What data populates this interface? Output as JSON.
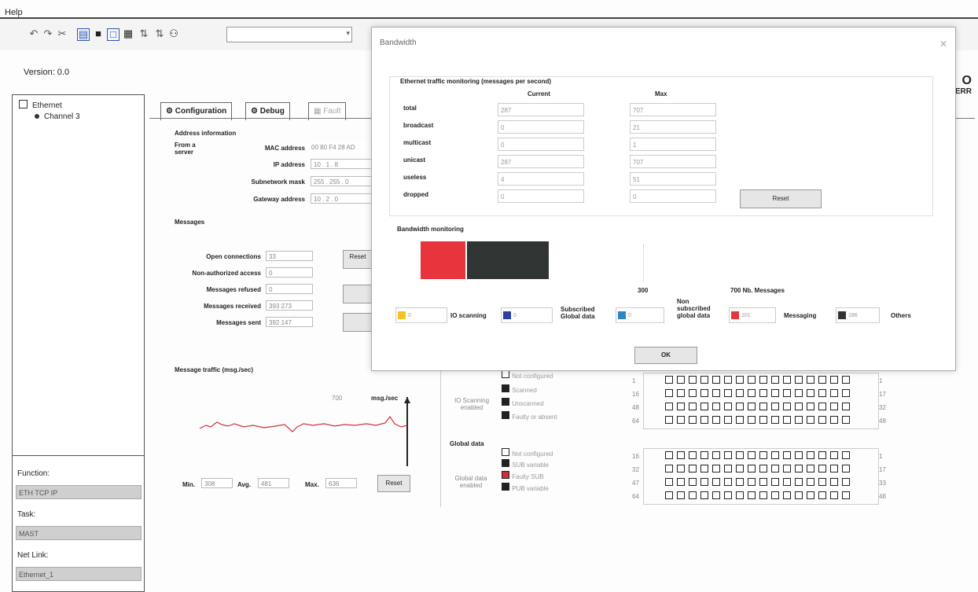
{
  "menu": {
    "help": "Help"
  },
  "toolbar": {
    "icons": [
      "undo-icon",
      "redo-icon",
      "cut-icon",
      "view-icon",
      "doc-icon",
      "frame-icon",
      "print-icon",
      "find-prev-icon",
      "find-next-icon",
      "binoculars-icon"
    ],
    "combo_value": ""
  },
  "version": "Version: 0.0",
  "corner_right": {
    "line1": "O",
    "line2": "ERR"
  },
  "tree": {
    "root": "Ethernet",
    "child": "Channel 3"
  },
  "left_fields": [
    {
      "label": "Function:",
      "value": "ETH TCP IP"
    },
    {
      "label": "Task:",
      "value": "MAST"
    },
    {
      "label": "Net Link:",
      "value": "Ethernet_1"
    }
  ],
  "tabs": [
    "Configuration",
    "Debug",
    "Fault"
  ],
  "address": {
    "title": "Address information",
    "from_label": "From a server",
    "rows": [
      {
        "label": "MAC address",
        "value": "00 80 F4 28 AD"
      },
      {
        "label": "IP address",
        "value": "10 . 1 . 8"
      },
      {
        "label": "Subnetwork mask",
        "value": "255 . 255 . 0"
      },
      {
        "label": "Gateway address",
        "value": "10 . 2 . 0"
      }
    ]
  },
  "messages": {
    "title": "Messages",
    "rows": [
      {
        "label": "Open connections",
        "value": "33"
      },
      {
        "label": "Non-authorized access",
        "value": "0"
      },
      {
        "label": "Messages refused",
        "value": "0"
      },
      {
        "label": "Messages received",
        "value": "393 273"
      },
      {
        "label": "Messages sent",
        "value": "392 147"
      }
    ],
    "reset_label": "Reset"
  },
  "traffic": {
    "title": "Message traffic (msg./sec)",
    "max_tick": "700",
    "unit": "msg./sec",
    "min_label": "Min.",
    "min_value": "308",
    "avg_label": "Avg.",
    "avg_value": "481",
    "max_label": "Max.",
    "max_value": "636",
    "reset_label": "Reset",
    "line_color": "#d0343a"
  },
  "io_scanning": {
    "label_line1": "IO Scanning",
    "label_line2": "enabled",
    "legend": [
      "Not configured",
      "Scanned",
      "Unscanned",
      "Faulty or absent"
    ],
    "row_left": [
      "1",
      "16",
      "48",
      "64"
    ],
    "row_right": [
      "1",
      "17",
      "32",
      "48"
    ]
  },
  "global_data": {
    "title": "Global data",
    "label_line1": "Global data",
    "label_line2": "enabled",
    "legend": [
      "Not configured",
      "SUB variable",
      "Faulty SUB",
      "PUB variable"
    ],
    "row_left": [
      "16",
      "32",
      "47",
      "64"
    ],
    "row_right": [
      "1",
      "17",
      "33",
      "48"
    ]
  },
  "bandwidth": {
    "title": "Bandwidth",
    "ethernet_title": "Ethernet traffic monitoring (messages per second)",
    "col_current": "Current",
    "col_max": "Max",
    "rows": [
      {
        "label": "total",
        "current": "287",
        "max": "707"
      },
      {
        "label": "broadcast",
        "current": "0",
        "max": "21"
      },
      {
        "label": "multicast",
        "current": "0",
        "max": "1"
      },
      {
        "label": "unicast",
        "current": "287",
        "max": "707"
      },
      {
        "label": "useless",
        "current": "4",
        "max": "51"
      },
      {
        "label": "dropped",
        "current": "0",
        "max": "0"
      }
    ],
    "reset_label": "Reset",
    "monitoring_title": "Bandwidth monitoring",
    "tick_300": "300",
    "tick_700": "700 Nb. Messages",
    "bar_messaging_fraction": 0.101,
    "bar_others_fraction": 0.186,
    "legend": [
      {
        "value": "0",
        "label": "IO scanning",
        "color": "#f3c523"
      },
      {
        "value": "0",
        "label": "Subscribed Global data",
        "color": "#2c3fa6"
      },
      {
        "value": "0",
        "label": "Non subscribed global data",
        "color": "#2b86c6"
      },
      {
        "value": "101",
        "label": "Messaging",
        "color": "#e8343c"
      },
      {
        "value": "186",
        "label": "Others",
        "color": "#303433"
      }
    ],
    "ok_label": "OK"
  }
}
